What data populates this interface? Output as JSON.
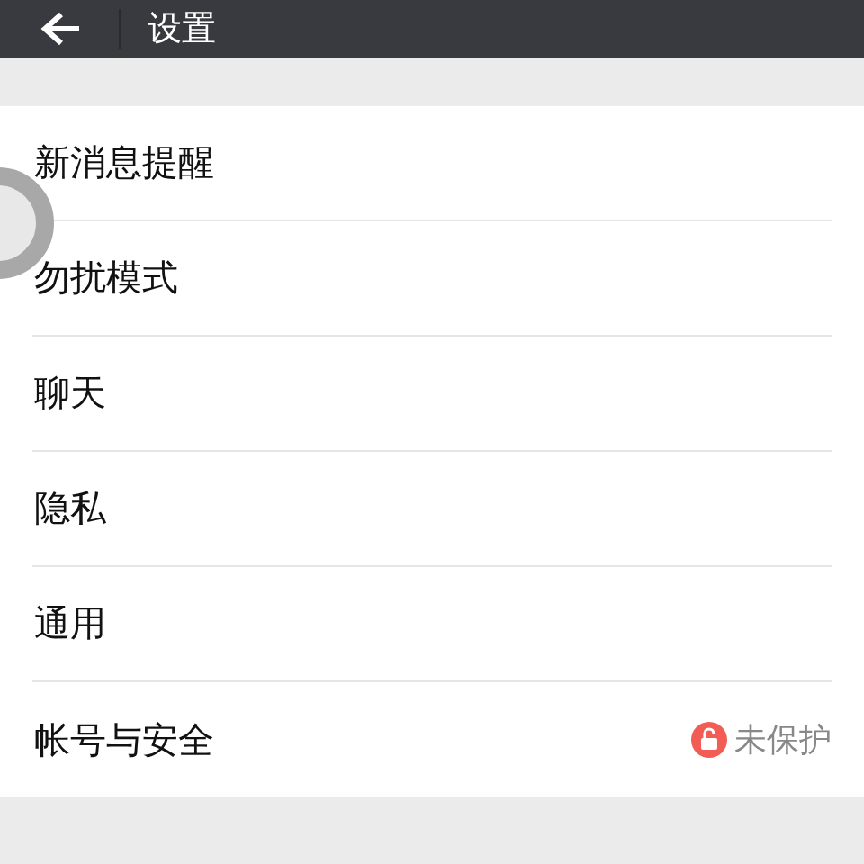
{
  "header": {
    "title": "设置"
  },
  "items": [
    {
      "label": "新消息提醒"
    },
    {
      "label": "勿扰模式"
    },
    {
      "label": "聊天"
    },
    {
      "label": "隐私"
    },
    {
      "label": "通用"
    },
    {
      "label": "帐号与安全",
      "status": "未保护"
    }
  ]
}
